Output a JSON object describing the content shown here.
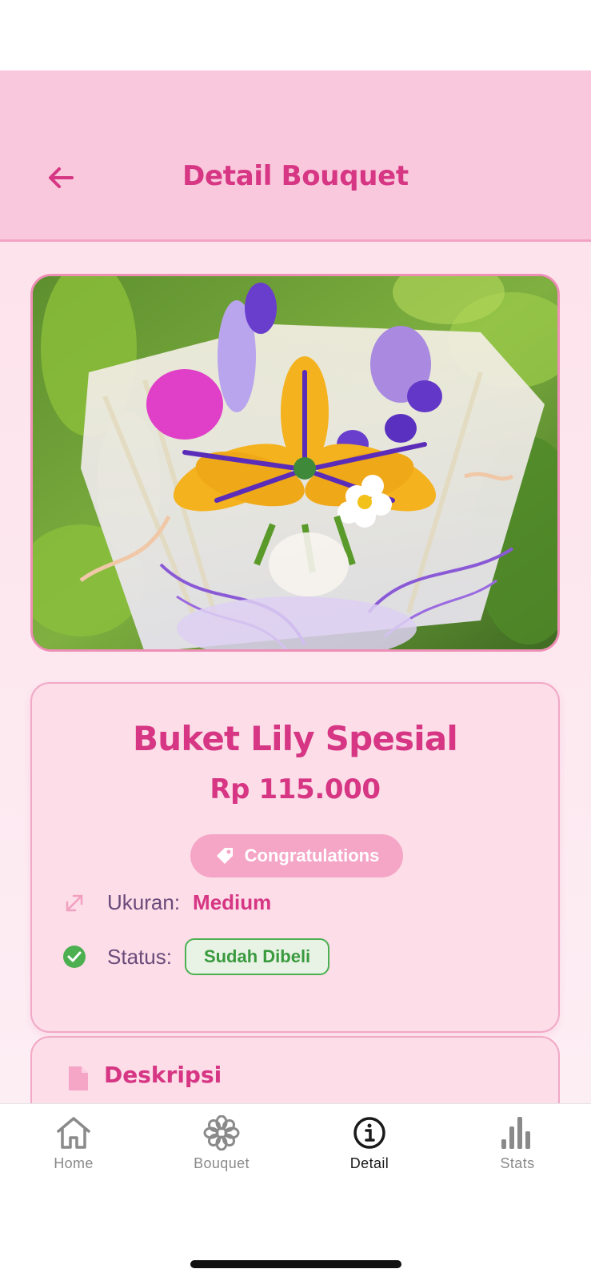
{
  "header": {
    "title": "Detail Bouquet",
    "back_icon": "arrow-left-icon",
    "color": "#d63683",
    "background": "#f9c8dc"
  },
  "bouquet": {
    "image_alt": "Buket Lily Spesial",
    "name": "Buket Lily Spesial",
    "price": "Rp 115.000",
    "category": "Congratulations",
    "category_icon": "tag-icon",
    "size_label": "Ukuran:",
    "size_value": "Medium",
    "size_icon": "resize-icon",
    "status_label": "Status:",
    "status_value": "Sudah Dibeli",
    "status_icon": "check-circle-icon",
    "status_color": "#4caf50"
  },
  "description": {
    "title": "Deskripsi",
    "icon": "document-icon"
  },
  "nav": {
    "items": [
      {
        "label": "Home",
        "icon": "home-icon",
        "active": false
      },
      {
        "label": "Bouquet",
        "icon": "flower-icon",
        "active": false
      },
      {
        "label": "Detail",
        "icon": "info-icon",
        "active": true
      },
      {
        "label": "Stats",
        "icon": "bar-chart-icon",
        "active": false
      }
    ]
  }
}
